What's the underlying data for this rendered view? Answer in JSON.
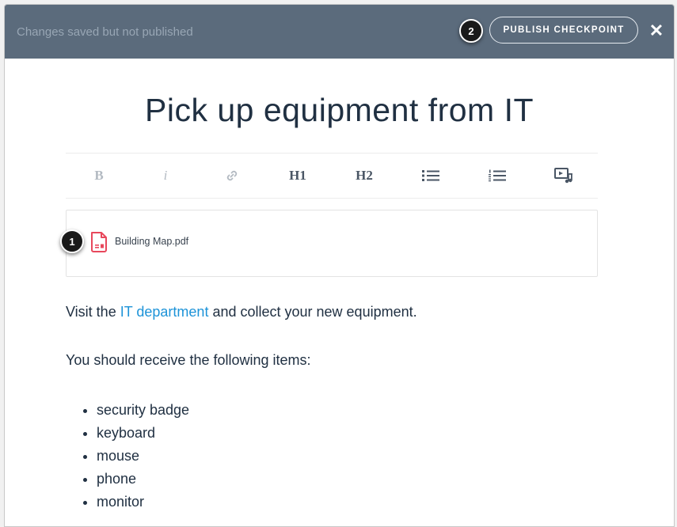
{
  "header": {
    "status_text": "Changes saved but not published",
    "publish_label": "PUBLISH CHECKPOINT",
    "close_glyph": "✕"
  },
  "callouts": {
    "one": "1",
    "two": "2"
  },
  "title": "Pick up equipment from IT",
  "toolbar": {
    "bold": "B",
    "italic": "i",
    "link_icon": "link-icon",
    "h1": "H1",
    "h2": "H2",
    "bullet_list_icon": "bullet-list-icon",
    "numbered_list_icon": "numbered-list-icon",
    "media_icon": "media-icon"
  },
  "attachment": {
    "file_name": "Building Map.pdf",
    "icon": "pdf-file-icon"
  },
  "body": {
    "intro_before": "Visit the ",
    "intro_link": "IT department",
    "intro_after": " and collect your new equipment.",
    "items_heading": "You should receive the following items:",
    "items": [
      "security badge",
      "keyboard",
      "mouse",
      "phone",
      "monitor"
    ]
  },
  "colors": {
    "topbar": "#5b6b7c",
    "title_text": "#203042",
    "link": "#1d93d8",
    "pdf_icon": "#e8485c"
  }
}
